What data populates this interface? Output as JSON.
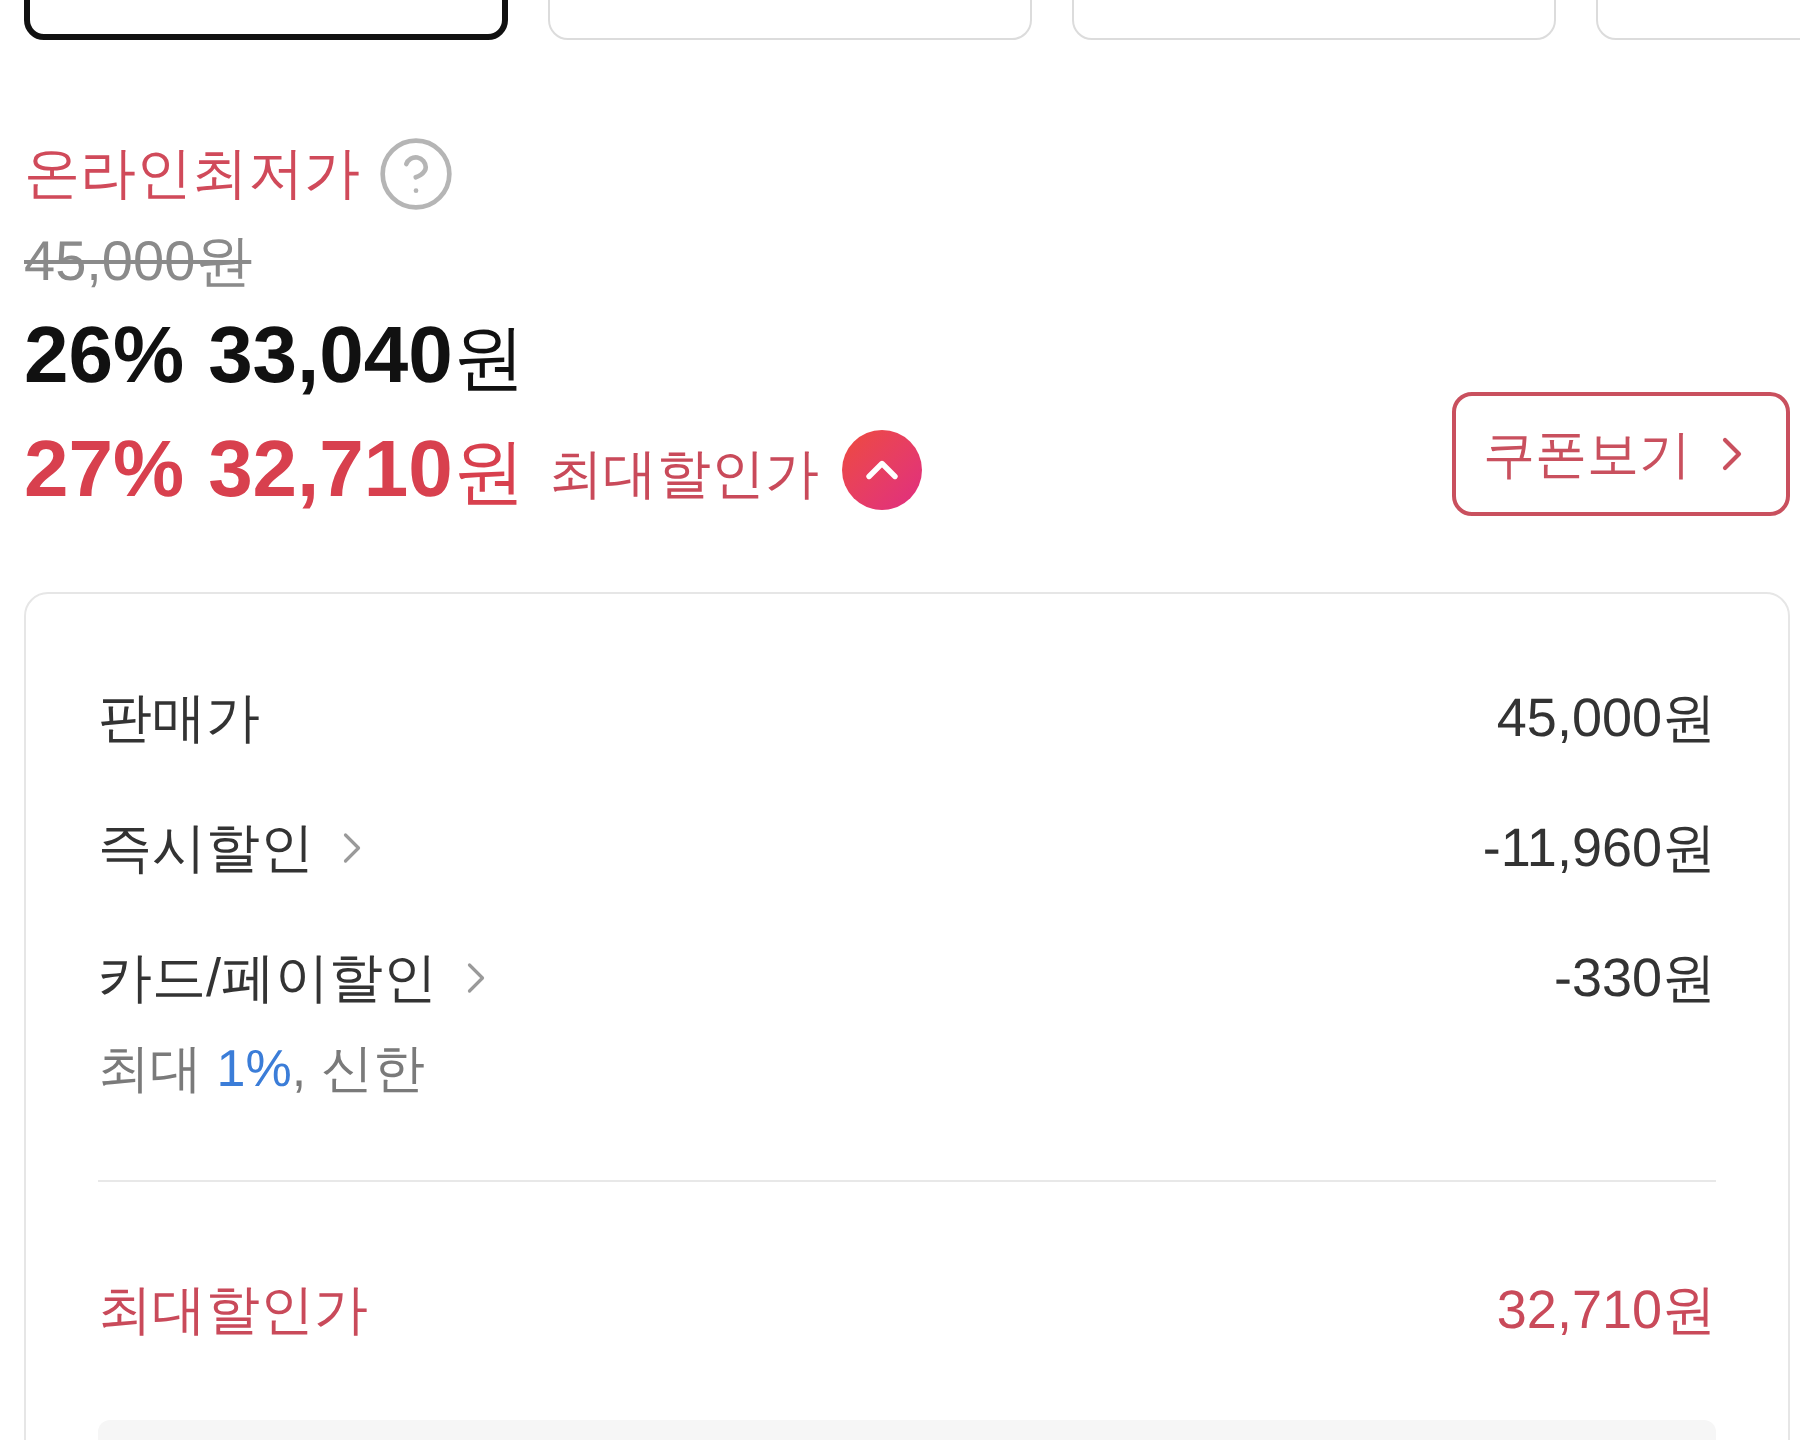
{
  "option_tiles": [
    {
      "selected": true
    },
    {
      "selected": false
    },
    {
      "selected": false
    },
    {
      "selected": false
    }
  ],
  "price": {
    "label": "온라인최저가",
    "original": "45,000원",
    "sale_rate": "26%",
    "sale_amount": "33,040",
    "sale_unit": "원",
    "max_rate": "27%",
    "max_amount": "32,710",
    "max_unit": "원",
    "max_label": "최대할인가",
    "expanded": true,
    "coupon_button": "쿠폰보기"
  },
  "breakdown": {
    "rows": [
      {
        "label": "판매가",
        "value": "45,000원",
        "link": false
      },
      {
        "label": "즉시할인",
        "value": "-11,960원",
        "link": true
      },
      {
        "label": "카드/페이할인",
        "value": "-330원",
        "link": true,
        "note": "최대 **1%**, 신한"
      }
    ],
    "total": {
      "label": "최대할인가",
      "value": "32,710원"
    }
  }
}
